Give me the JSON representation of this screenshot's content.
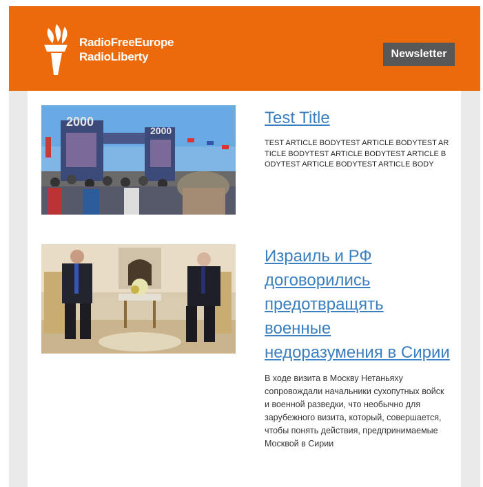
{
  "header": {
    "logo_line1": "RadioFreeEurope",
    "logo_line2": "RadioLiberty",
    "newsletter_label": "Newsletter",
    "brand_color": "#ec6a0b"
  },
  "articles": [
    {
      "title": "Test Title",
      "body": "TEST ARTICLE BODYTEST ARTICLE BODYTEST ARTICLE BODYTEST ARTICLE BODYTEST ARTICLE BODYTEST ARTICLE BODYTEST ARTICLE BODY",
      "image_sign1": "2000",
      "image_sign2": "2000"
    },
    {
      "title": "Израиль и РФ договорились предотвращять военные недоразумения в Сирии",
      "body": "В ходе визита в Москву Нетаньяху сопровождали начальники сухопутных войск и военной разведки, что необычно для зарубежного визита, который, совершается, чтобы понять действия, предпринимаемые Москвой в Сирии"
    }
  ]
}
